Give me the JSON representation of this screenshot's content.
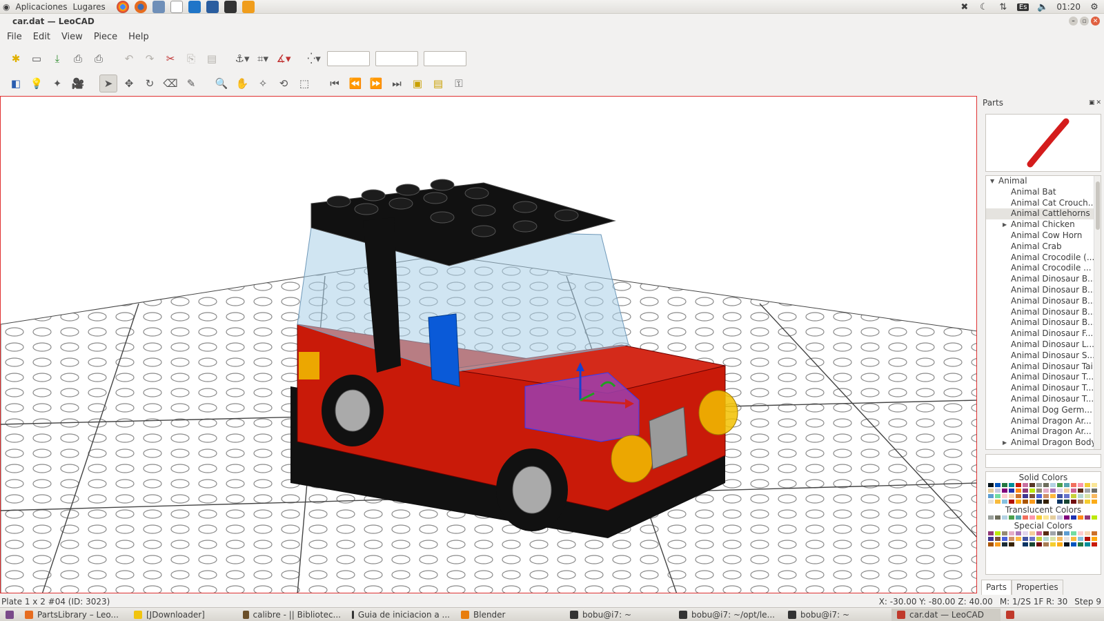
{
  "top_panel": {
    "applications": "Aplicaciones",
    "places": "Lugares",
    "keyboard_layout": "Es",
    "clock": "01:20"
  },
  "window": {
    "title": "car.dat — LeoCAD"
  },
  "menu": {
    "file": "File",
    "edit": "Edit",
    "view": "View",
    "piece": "Piece",
    "help": "Help"
  },
  "parts_panel": {
    "title": "Parts",
    "tree": [
      {
        "label": "Animal",
        "root": true,
        "expanded": true
      },
      {
        "label": "Animal Bat"
      },
      {
        "label": "Animal Cat Crouch..."
      },
      {
        "label": "Animal Cattlehorns",
        "selected": true
      },
      {
        "label": "Animal Chicken",
        "collapsed": true
      },
      {
        "label": "Animal Cow Horn"
      },
      {
        "label": "Animal Crab"
      },
      {
        "label": "Animal Crocodile (..."
      },
      {
        "label": "Animal Crocodile ..."
      },
      {
        "label": "Animal Dinosaur B..."
      },
      {
        "label": "Animal Dinosaur B..."
      },
      {
        "label": "Animal Dinosaur B..."
      },
      {
        "label": "Animal Dinosaur B..."
      },
      {
        "label": "Animal Dinosaur B..."
      },
      {
        "label": "Animal Dinosaur F..."
      },
      {
        "label": "Animal Dinosaur L..."
      },
      {
        "label": "Animal Dinosaur S..."
      },
      {
        "label": "Animal Dinosaur Tail"
      },
      {
        "label": "Animal Dinosaur T..."
      },
      {
        "label": "Animal Dinosaur T..."
      },
      {
        "label": "Animal Dinosaur T..."
      },
      {
        "label": "Animal Dog Germ..."
      },
      {
        "label": "Animal Dragon Ar..."
      },
      {
        "label": "Animal Dragon Ar..."
      },
      {
        "label": "Animal Dragon Body",
        "collapsed": true
      }
    ],
    "solid_colors_label": "Solid Colors",
    "translucent_colors_label": "Translucent Colors",
    "special_colors_label": "Special Colors",
    "tab_parts": "Parts",
    "tab_properties": "Properties"
  },
  "status": {
    "piece": "Plate  1 x  2 #04 (ID: 3023)",
    "coords": "X: -30.00 Y: -80.00 Z: 40.00",
    "grid": "M: 1/2S 1F R: 30",
    "step": "Step 9"
  },
  "taskbar": [
    {
      "label": "PartsLibrary – Leo...",
      "color": "#e66c1f"
    },
    {
      "label": "[JDownloader]",
      "color": "#f1c40f"
    },
    {
      "label": "calibre - || Bibliotec...",
      "color": "#6b4f2a"
    },
    {
      "label": "Guia de iniciacion a ...",
      "color": "#333333"
    },
    {
      "label": "Blender",
      "color": "#e87d0d"
    },
    {
      "label": "bobu@i7: ~",
      "color": "#333333"
    },
    {
      "label": "bobu@i7: ~/opt/le...",
      "color": "#333333"
    },
    {
      "label": "bobu@i7: ~",
      "color": "#333333"
    },
    {
      "label": "car.dat — LeoCAD",
      "color": "#c0392b",
      "active": true
    }
  ],
  "colors": {
    "accent_red": "#e03030",
    "brick_red": "#c91a09",
    "brick_black": "#111111",
    "brick_yellow": "#f2c100"
  }
}
